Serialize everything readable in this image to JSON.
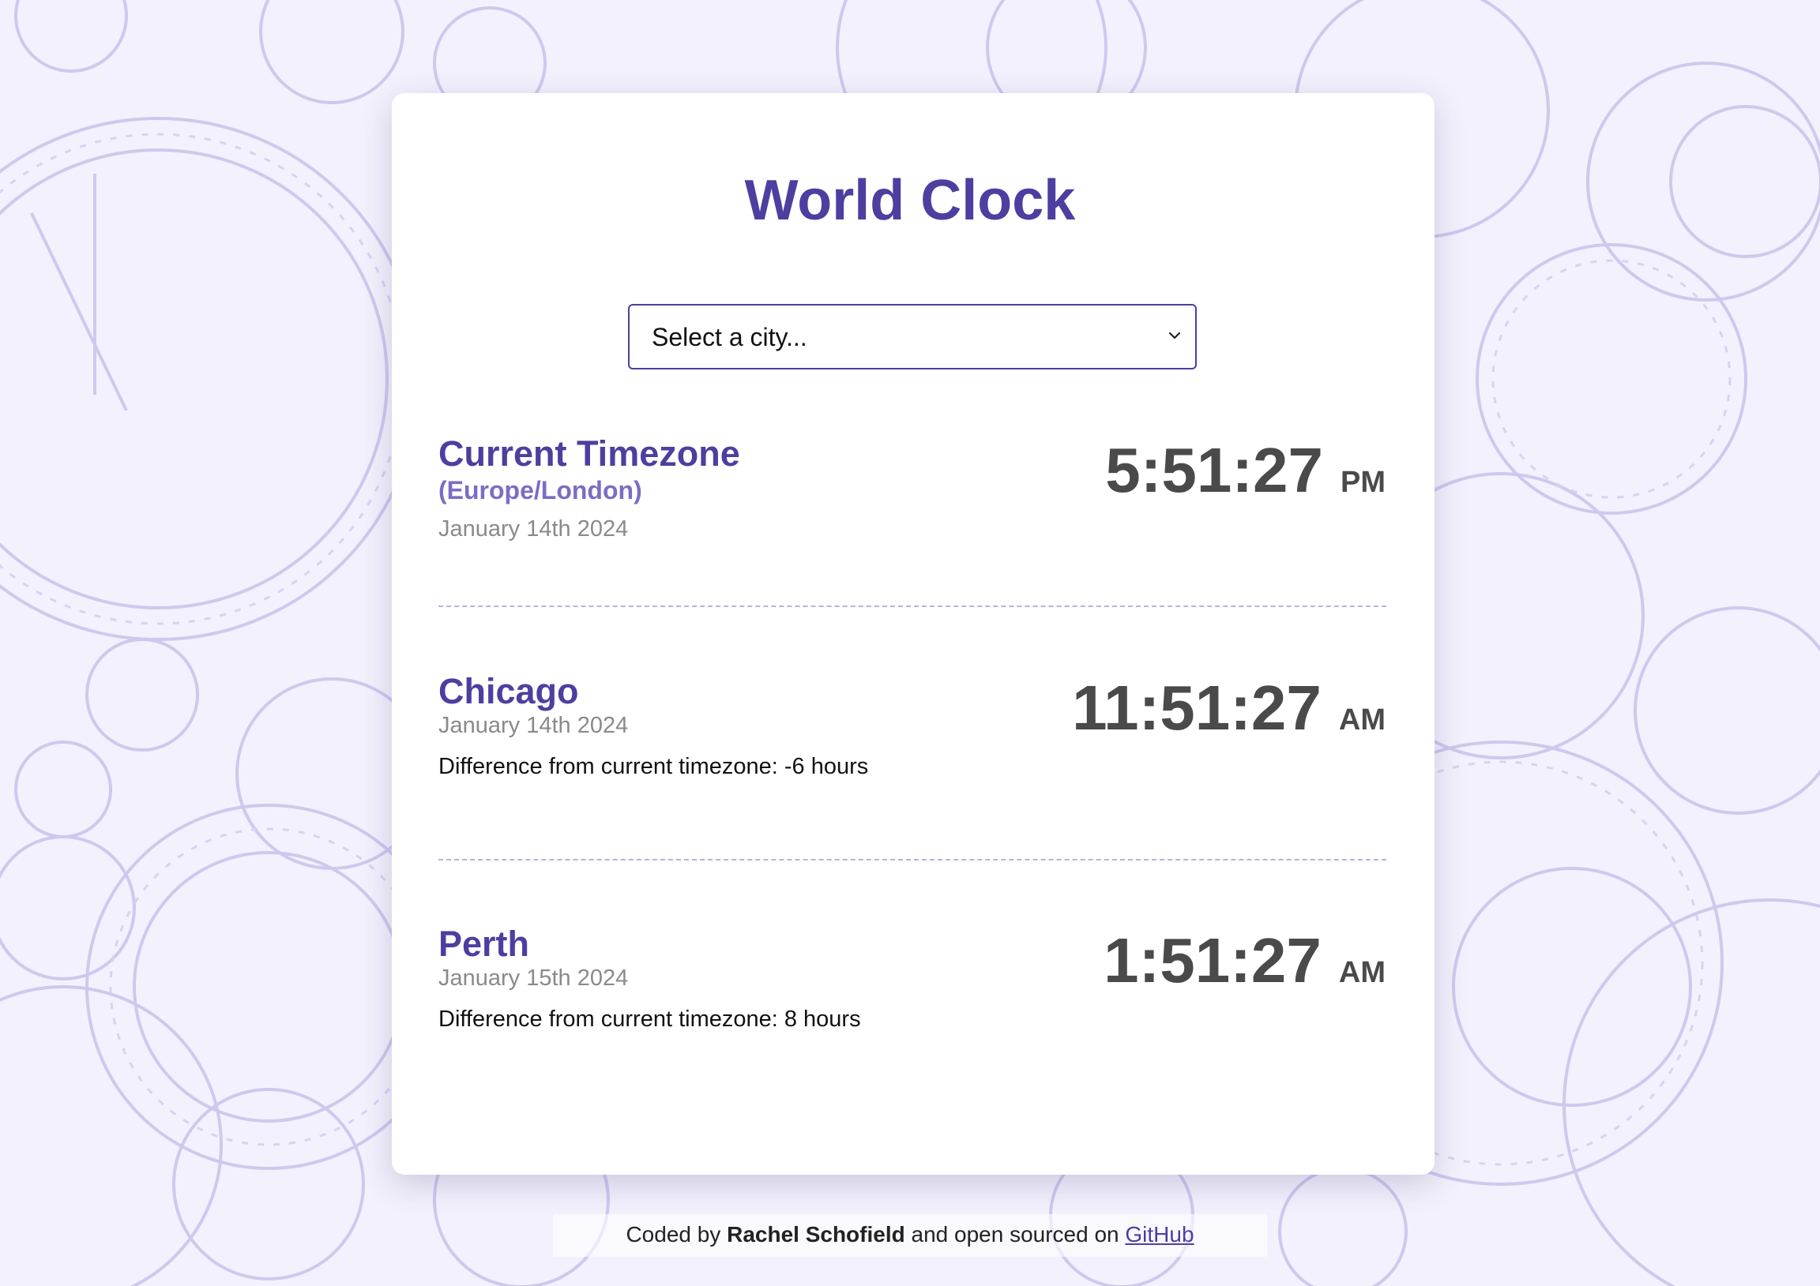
{
  "app": {
    "title": "World Clock"
  },
  "city_select": {
    "placeholder": "Select a city..."
  },
  "entries": [
    {
      "name": "Current Timezone",
      "timezone": "(Europe/London)",
      "date": "January 14th 2024",
      "time": "5:51:27",
      "ampm": "PM"
    },
    {
      "name": "Chicago",
      "date": "January 14th 2024",
      "difference": "Difference from current timezone: -6 hours",
      "time": "11:51:27",
      "ampm": "AM"
    },
    {
      "name": "Perth",
      "date": "January 15th 2024",
      "difference": "Difference from current timezone: 8 hours",
      "time": "1:51:27",
      "ampm": "AM"
    }
  ],
  "footer": {
    "prefix": "Coded by ",
    "author": "Rachel Schofield",
    "middle": " and open sourced on ",
    "link": "GitHub"
  },
  "colors": {
    "accent": "#4c3fa0",
    "accent_light": "#7d6cc4",
    "background": "#f3f1fd",
    "time_text": "#4a4a4a",
    "date_text": "#8a8a8a"
  },
  "icons": {
    "select_arrow": "chevron-down-icon",
    "background": "clock-faces-pattern"
  }
}
